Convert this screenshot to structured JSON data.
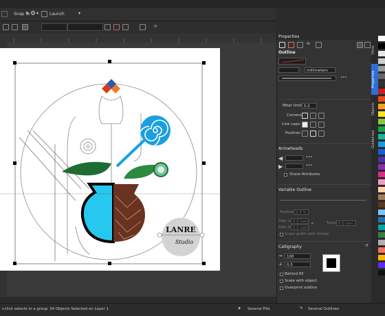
{
  "toolbar": {
    "snap_label": "Snap To",
    "launch_label": "Launch",
    "settings_icon": "gear-icon"
  },
  "status": {
    "hint": "+click selects in a group",
    "selection": "34 Objects Selected on Layer 1",
    "fill": "Several Fills",
    "outline": "Several Outlines"
  },
  "panel": {
    "title": "Properties",
    "outline_heading": "Outline",
    "units": "millimeters",
    "miter_label": "Miter limit:",
    "miter_value": "5.0",
    "corners_label": "Corners:",
    "linecaps_label": "Line caps:",
    "position_label": "Position:",
    "arrowheads_heading": "Arrowheads",
    "share_attributes": "Share Attributes",
    "variable_outline_heading": "Variable Outline",
    "var_position_label": "Position:",
    "var_position_value": "0.0 %",
    "side1_label": "Side 1:",
    "side1_value": "0.0 mm",
    "side2_label": "Side 2:",
    "side2_value": "0.0 mm",
    "total_label": "Total:",
    "total_value": "0.0 mm",
    "scale_width_stroke": "Scale width with Stroke",
    "calligraphy_heading": "Calligraphy",
    "stretch_value": "100",
    "angle_value": "0.0",
    "behind_fill": "Behind fill",
    "scale_with_object": "Scale with object",
    "overprint_outline": "Overprint outline"
  },
  "side_tabs": [
    "Hints",
    "Properties",
    "Objects",
    "Guidelines"
  ],
  "logo": {
    "line1": "LANRE",
    "line2": "Studio"
  },
  "palette_colors": [
    "#ffffff",
    "#000000",
    "#e6e6e6",
    "#cccccc",
    "#999999",
    "#666666",
    "#333333",
    "#c81d25",
    "#e84a1c",
    "#f7a21a",
    "#f7e31a",
    "#8bc53f",
    "#1aa24b",
    "#1ab1a3",
    "#1a9ad6",
    "#1a5ed6",
    "#4d2fa6",
    "#8b2fa6",
    "#d62f8b",
    "#f29bc2",
    "#ffd1a6",
    "#a67c52",
    "#5c3a1e",
    "#7ac5ff",
    "#2b6cb0",
    "#00a6a6",
    "#3a7d44",
    "#b0b0b0",
    "#ff6f61",
    "#ffb400",
    "#5e2bff",
    "#111111"
  ],
  "colors": {
    "accent": "#2d6fd6",
    "cyan": "#27c8ef",
    "green": "#1f7a3a",
    "brown": "#6a3320",
    "blue_swirl": "#1c9fe0"
  }
}
